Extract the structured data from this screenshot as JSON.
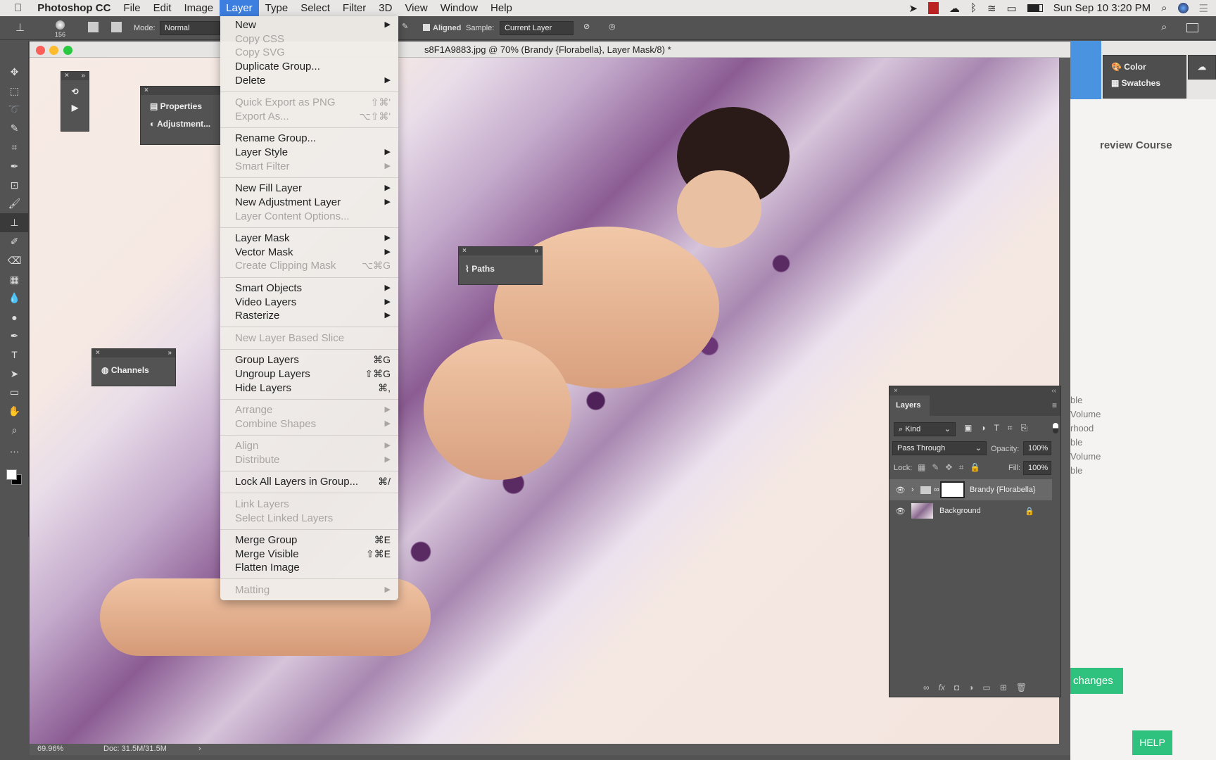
{
  "menubar": {
    "app": "Photoshop CC",
    "items": [
      "File",
      "Edit",
      "Image",
      "Layer",
      "Type",
      "Select",
      "Filter",
      "3D",
      "View",
      "Window",
      "Help"
    ],
    "active": "Layer",
    "datetime": "Sun Sep 10  3:20 PM"
  },
  "options": {
    "brush_size": "156",
    "mode_label": "Mode:",
    "mode": "Normal",
    "aligned": "Aligned",
    "sample_label": "Sample:",
    "sample": "Current Layer"
  },
  "document": {
    "title": "s8F1A9883.jpg @ 70% (Brandy {Florabella}, Layer Mask/8) *",
    "zoom": "69.96%",
    "doc_size": "Doc: 31.5M/31.5M"
  },
  "panels": {
    "properties": "Properties",
    "adjustments": "Adjustment...",
    "channels": "Channels",
    "paths": "Paths",
    "color": "Color",
    "swatches": "Swatches"
  },
  "layer_menu": [
    {
      "label": "New",
      "sub": true
    },
    {
      "label": "Copy CSS",
      "dis": true
    },
    {
      "label": "Copy SVG",
      "dis": true
    },
    {
      "label": "Duplicate Group..."
    },
    {
      "label": "Delete",
      "sub": true
    },
    {
      "sep": true
    },
    {
      "label": "Quick Export as PNG",
      "dis": true,
      "sc": "⇧⌘'"
    },
    {
      "label": "Export As...",
      "dis": true,
      "sc": "⌥⇧⌘'"
    },
    {
      "sep": true
    },
    {
      "label": "Rename Group..."
    },
    {
      "label": "Layer Style",
      "sub": true
    },
    {
      "label": "Smart Filter",
      "dis": true,
      "sub": true
    },
    {
      "sep": true
    },
    {
      "label": "New Fill Layer",
      "sub": true
    },
    {
      "label": "New Adjustment Layer",
      "sub": true
    },
    {
      "label": "Layer Content Options...",
      "dis": true
    },
    {
      "sep": true
    },
    {
      "label": "Layer Mask",
      "sub": true
    },
    {
      "label": "Vector Mask",
      "sub": true
    },
    {
      "label": "Create Clipping Mask",
      "dis": true,
      "sc": "⌥⌘G"
    },
    {
      "sep": true
    },
    {
      "label": "Smart Objects",
      "sub": true
    },
    {
      "label": "Video Layers",
      "sub": true
    },
    {
      "label": "Rasterize",
      "sub": true
    },
    {
      "sep": true
    },
    {
      "label": "New Layer Based Slice",
      "dis": true
    },
    {
      "sep": true
    },
    {
      "label": "Group Layers",
      "sc": "⌘G"
    },
    {
      "label": "Ungroup Layers",
      "sc": "⇧⌘G"
    },
    {
      "label": "Hide Layers",
      "sc": "⌘,"
    },
    {
      "sep": true
    },
    {
      "label": "Arrange",
      "dis": true,
      "sub": true
    },
    {
      "label": "Combine Shapes",
      "dis": true,
      "sub": true
    },
    {
      "sep": true
    },
    {
      "label": "Align",
      "dis": true,
      "sub": true
    },
    {
      "label": "Distribute",
      "dis": true,
      "sub": true
    },
    {
      "sep": true
    },
    {
      "label": "Lock All Layers in Group...",
      "sc": "⌘/"
    },
    {
      "sep": true
    },
    {
      "label": "Link Layers",
      "dis": true
    },
    {
      "label": "Select Linked Layers",
      "dis": true
    },
    {
      "sep": true
    },
    {
      "label": "Merge Group",
      "sc": "⌘E"
    },
    {
      "label": "Merge Visible",
      "sc": "⇧⌘E"
    },
    {
      "label": "Flatten Image"
    },
    {
      "sep": true
    },
    {
      "label": "Matting",
      "dis": true,
      "sub": true
    }
  ],
  "layers": {
    "title": "Layers",
    "filter": "Kind",
    "blend": "Pass Through",
    "opacity_label": "Opacity:",
    "opacity": "100%",
    "lock_label": "Lock:",
    "fill_label": "Fill:",
    "fill": "100%",
    "rows": [
      {
        "name": "Brandy {Florabella}",
        "type": "group"
      },
      {
        "name": "Background",
        "type": "image",
        "locked": true
      }
    ]
  },
  "background_page": {
    "preview": "review Course",
    "list": [
      "ble",
      "Volume",
      "rhood",
      "ble",
      "Volume",
      "ble"
    ],
    "changes": "changes",
    "help": "HELP"
  }
}
